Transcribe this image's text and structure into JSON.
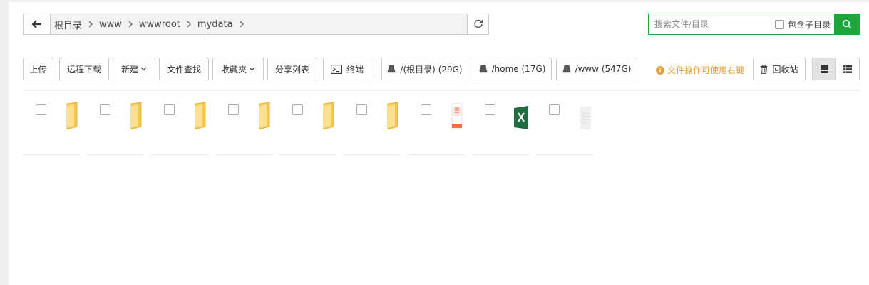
{
  "breadcrumb": {
    "items": [
      {
        "label": "根目录"
      },
      {
        "label": "www"
      },
      {
        "label": "wwwroot"
      },
      {
        "label": "mydata"
      }
    ]
  },
  "search": {
    "placeholder": "搜索文件/目录",
    "include_subdirs_label": "包含子目录"
  },
  "toolbar": {
    "upload": "上传",
    "remote_download": "远程下载",
    "new": "新建",
    "file_search": "文件查找",
    "favorites": "收藏夹",
    "share_list": "分享列表",
    "terminal": "终端",
    "disks": [
      {
        "label": "/(根目录) (29G)"
      },
      {
        "label": "/home (17G)"
      },
      {
        "label": "/www (547G)"
      }
    ],
    "tip": "文件操作可使用右键",
    "recycle_bin": "回收站"
  },
  "colors": {
    "accent": "#20a53a",
    "warning": "#e6a23c",
    "folder": "#f5c84c",
    "excel": "#1d6f42"
  },
  "files": [
    {
      "type": "folder",
      "icon": "folder-icon"
    },
    {
      "type": "folder",
      "icon": "folder-icon"
    },
    {
      "type": "folder",
      "icon": "folder-icon"
    },
    {
      "type": "folder",
      "icon": "folder-icon"
    },
    {
      "type": "folder",
      "icon": "folder-icon"
    },
    {
      "type": "folder",
      "icon": "folder-icon"
    },
    {
      "type": "rar",
      "icon": "archive-file-icon"
    },
    {
      "type": "excel",
      "icon": "excel-file-icon"
    },
    {
      "type": "text",
      "icon": "text-file-icon"
    }
  ]
}
